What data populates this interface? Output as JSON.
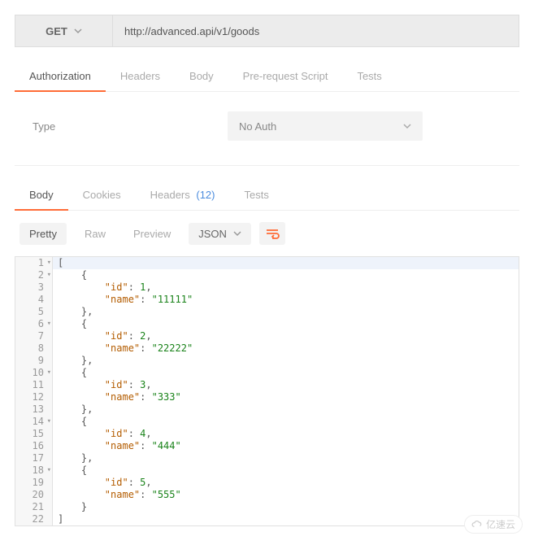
{
  "request": {
    "method": "GET",
    "url": "http://advanced.api/v1/goods"
  },
  "request_tabs": [
    {
      "label": "Authorization",
      "active": true
    },
    {
      "label": "Headers",
      "active": false
    },
    {
      "label": "Body",
      "active": false
    },
    {
      "label": "Pre-request Script",
      "active": false
    },
    {
      "label": "Tests",
      "active": false
    }
  ],
  "auth": {
    "type_label": "Type",
    "selected": "No Auth"
  },
  "response_tabs": [
    {
      "label": "Body",
      "active": true
    },
    {
      "label": "Cookies",
      "active": false
    },
    {
      "label": "Headers",
      "count": "(12)",
      "active": false
    },
    {
      "label": "Tests",
      "active": false
    }
  ],
  "view_modes": {
    "pretty": "Pretty",
    "raw": "Raw",
    "preview": "Preview",
    "format": "JSON"
  },
  "code_lines": [
    {
      "n": 1,
      "fold": true,
      "hl": true,
      "indent": 0,
      "tokens": [
        {
          "t": "p",
          "v": "["
        }
      ]
    },
    {
      "n": 2,
      "fold": true,
      "indent": 1,
      "tokens": [
        {
          "t": "p",
          "v": "{"
        }
      ]
    },
    {
      "n": 3,
      "indent": 2,
      "tokens": [
        {
          "t": "k",
          "v": "\"id\""
        },
        {
          "t": "p",
          "v": ": "
        },
        {
          "t": "n",
          "v": "1"
        },
        {
          "t": "p",
          "v": ","
        }
      ]
    },
    {
      "n": 4,
      "indent": 2,
      "tokens": [
        {
          "t": "k",
          "v": "\"name\""
        },
        {
          "t": "p",
          "v": ": "
        },
        {
          "t": "s",
          "v": "\"11111\""
        }
      ]
    },
    {
      "n": 5,
      "indent": 1,
      "tokens": [
        {
          "t": "p",
          "v": "},"
        }
      ]
    },
    {
      "n": 6,
      "fold": true,
      "indent": 1,
      "tokens": [
        {
          "t": "p",
          "v": "{"
        }
      ]
    },
    {
      "n": 7,
      "indent": 2,
      "tokens": [
        {
          "t": "k",
          "v": "\"id\""
        },
        {
          "t": "p",
          "v": ": "
        },
        {
          "t": "n",
          "v": "2"
        },
        {
          "t": "p",
          "v": ","
        }
      ]
    },
    {
      "n": 8,
      "indent": 2,
      "tokens": [
        {
          "t": "k",
          "v": "\"name\""
        },
        {
          "t": "p",
          "v": ": "
        },
        {
          "t": "s",
          "v": "\"22222\""
        }
      ]
    },
    {
      "n": 9,
      "indent": 1,
      "tokens": [
        {
          "t": "p",
          "v": "},"
        }
      ]
    },
    {
      "n": 10,
      "fold": true,
      "indent": 1,
      "tokens": [
        {
          "t": "p",
          "v": "{"
        }
      ]
    },
    {
      "n": 11,
      "indent": 2,
      "tokens": [
        {
          "t": "k",
          "v": "\"id\""
        },
        {
          "t": "p",
          "v": ": "
        },
        {
          "t": "n",
          "v": "3"
        },
        {
          "t": "p",
          "v": ","
        }
      ]
    },
    {
      "n": 12,
      "indent": 2,
      "tokens": [
        {
          "t": "k",
          "v": "\"name\""
        },
        {
          "t": "p",
          "v": ": "
        },
        {
          "t": "s",
          "v": "\"333\""
        }
      ]
    },
    {
      "n": 13,
      "indent": 1,
      "tokens": [
        {
          "t": "p",
          "v": "},"
        }
      ]
    },
    {
      "n": 14,
      "fold": true,
      "indent": 1,
      "tokens": [
        {
          "t": "p",
          "v": "{"
        }
      ]
    },
    {
      "n": 15,
      "indent": 2,
      "tokens": [
        {
          "t": "k",
          "v": "\"id\""
        },
        {
          "t": "p",
          "v": ": "
        },
        {
          "t": "n",
          "v": "4"
        },
        {
          "t": "p",
          "v": ","
        }
      ]
    },
    {
      "n": 16,
      "indent": 2,
      "tokens": [
        {
          "t": "k",
          "v": "\"name\""
        },
        {
          "t": "p",
          "v": ": "
        },
        {
          "t": "s",
          "v": "\"444\""
        }
      ]
    },
    {
      "n": 17,
      "indent": 1,
      "tokens": [
        {
          "t": "p",
          "v": "},"
        }
      ]
    },
    {
      "n": 18,
      "fold": true,
      "indent": 1,
      "tokens": [
        {
          "t": "p",
          "v": "{"
        }
      ]
    },
    {
      "n": 19,
      "indent": 2,
      "tokens": [
        {
          "t": "k",
          "v": "\"id\""
        },
        {
          "t": "p",
          "v": ": "
        },
        {
          "t": "n",
          "v": "5"
        },
        {
          "t": "p",
          "v": ","
        }
      ]
    },
    {
      "n": 20,
      "indent": 2,
      "tokens": [
        {
          "t": "k",
          "v": "\"name\""
        },
        {
          "t": "p",
          "v": ": "
        },
        {
          "t": "s",
          "v": "\"555\""
        }
      ]
    },
    {
      "n": 21,
      "indent": 1,
      "tokens": [
        {
          "t": "p",
          "v": "}"
        }
      ]
    },
    {
      "n": 22,
      "indent": 0,
      "tokens": [
        {
          "t": "p",
          "v": "]"
        }
      ]
    }
  ],
  "watermark": "亿速云"
}
